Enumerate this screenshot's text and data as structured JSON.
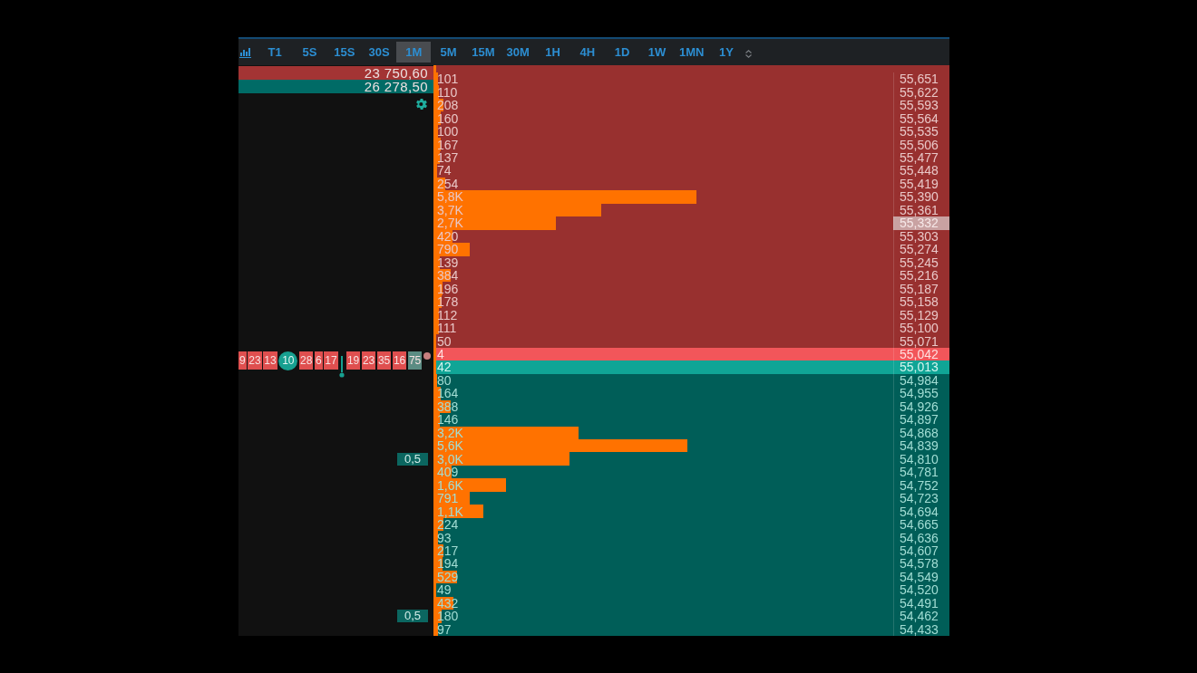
{
  "toolbar": {
    "timeframes": [
      {
        "label": "T1",
        "selected": false
      },
      {
        "label": "5S",
        "selected": false
      },
      {
        "label": "15S",
        "selected": false
      },
      {
        "label": "30S",
        "selected": false
      },
      {
        "label": "1M",
        "selected": true
      },
      {
        "label": "5M",
        "selected": false
      },
      {
        "label": "15M",
        "selected": false
      },
      {
        "label": "30M",
        "selected": false
      },
      {
        "label": "1H",
        "selected": false
      },
      {
        "label": "4H",
        "selected": false
      },
      {
        "label": "1D",
        "selected": false
      },
      {
        "label": "1W",
        "selected": false
      },
      {
        "label": "1MN",
        "selected": false
      },
      {
        "label": "1Y",
        "selected": false
      }
    ]
  },
  "totals": [
    {
      "value": "23 750,60",
      "color": "#a33434"
    },
    {
      "value": "26 278,50",
      "color": "#006b66"
    }
  ],
  "trades": [
    {
      "label": "9",
      "color": "#df4f4f",
      "kind": "box"
    },
    {
      "label": "23",
      "color": "#df4f4f",
      "kind": "box"
    },
    {
      "label": "13",
      "color": "#df4f4f",
      "kind": "box"
    },
    {
      "label": "10",
      "color": "#17a090",
      "kind": "bubble"
    },
    {
      "label": "28",
      "color": "#df4f4f",
      "kind": "box"
    },
    {
      "label": "6",
      "color": "#df4f4f",
      "kind": "box"
    },
    {
      "label": "17",
      "color": "#df4f4f",
      "kind": "box"
    },
    {
      "color": "#17a090",
      "kind": "pin"
    },
    {
      "label": "19",
      "color": "#df4f4f",
      "kind": "box"
    },
    {
      "label": "23",
      "color": "#df4f4f",
      "kind": "box"
    },
    {
      "label": "35",
      "color": "#df4f4f",
      "kind": "box"
    },
    {
      "label": "16",
      "color": "#df4f4f",
      "kind": "box"
    },
    {
      "label": "75",
      "color": "#5b8c83",
      "kind": "box"
    },
    {
      "color": "#c77f7f",
      "kind": "dot"
    }
  ],
  "ladder": {
    "rows": [
      {
        "kind": "ask",
        "volume": "101",
        "level": 0.01,
        "price": "55,651",
        "last_trade": false
      },
      {
        "kind": "ask",
        "volume": "110",
        "level": 0.011,
        "price": "55,622",
        "last_trade": false
      },
      {
        "kind": "ask",
        "volume": "208",
        "level": 0.021,
        "price": "55,593",
        "last_trade": false
      },
      {
        "kind": "ask",
        "volume": "160",
        "level": 0.016,
        "price": "55,564",
        "last_trade": false
      },
      {
        "kind": "ask",
        "volume": "100",
        "level": 0.01,
        "price": "55,535",
        "last_trade": false
      },
      {
        "kind": "ask",
        "volume": "167",
        "level": 0.016,
        "price": "55,506",
        "last_trade": false
      },
      {
        "kind": "ask",
        "volume": "137",
        "level": 0.014,
        "price": "55,477",
        "last_trade": false
      },
      {
        "kind": "ask",
        "volume": "74",
        "level": 0.007,
        "price": "55,448",
        "last_trade": false
      },
      {
        "kind": "ask",
        "volume": "254",
        "level": 0.025,
        "price": "55,419",
        "last_trade": false
      },
      {
        "kind": "ask",
        "volume": "5,8K",
        "level": 0.572,
        "price": "55,390",
        "last_trade": false
      },
      {
        "kind": "ask",
        "volume": "3,7K",
        "level": 0.365,
        "price": "55,361",
        "last_trade": false
      },
      {
        "kind": "ask",
        "volume": "2,7K",
        "level": 0.266,
        "price": "55,332",
        "last_trade": true
      },
      {
        "kind": "ask",
        "volume": "420",
        "level": 0.041,
        "price": "55,303",
        "last_trade": false
      },
      {
        "kind": "ask",
        "volume": "790",
        "level": 0.078,
        "price": "55,274",
        "last_trade": false
      },
      {
        "kind": "ask",
        "volume": "139",
        "level": 0.014,
        "price": "55,245",
        "last_trade": false
      },
      {
        "kind": "ask",
        "volume": "384",
        "level": 0.038,
        "price": "55,216",
        "last_trade": false
      },
      {
        "kind": "ask",
        "volume": "196",
        "level": 0.019,
        "price": "55,187",
        "last_trade": false
      },
      {
        "kind": "ask",
        "volume": "178",
        "level": 0.018,
        "price": "55,158",
        "last_trade": false
      },
      {
        "kind": "ask",
        "volume": "112",
        "level": 0.011,
        "price": "55,129",
        "last_trade": false
      },
      {
        "kind": "ask",
        "volume": "111",
        "level": 0.011,
        "price": "55,100",
        "last_trade": false
      },
      {
        "kind": "ask",
        "volume": "50",
        "level": 0.005,
        "price": "55,071",
        "last_trade": false
      },
      {
        "kind": "best_ask",
        "volume": "4",
        "level": 0,
        "price": "55,042",
        "last_trade": false
      },
      {
        "kind": "best_bid",
        "volume": "42",
        "level": 0.004,
        "price": "55,013",
        "last_trade": false
      },
      {
        "kind": "bid",
        "volume": "80",
        "level": 0.008,
        "price": "54,984",
        "last_trade": false
      },
      {
        "kind": "bid",
        "volume": "164",
        "level": 0.016,
        "price": "54,955",
        "last_trade": false
      },
      {
        "kind": "bid",
        "volume": "388",
        "level": 0.038,
        "price": "54,926",
        "last_trade": false
      },
      {
        "kind": "bid",
        "volume": "146",
        "level": 0.014,
        "price": "54,897",
        "last_trade": false
      },
      {
        "kind": "bid",
        "volume": "3,2K",
        "level": 0.316,
        "price": "54,868",
        "last_trade": false
      },
      {
        "kind": "bid",
        "volume": "5,6K",
        "level": 0.552,
        "price": "54,839",
        "last_trade": false
      },
      {
        "kind": "bid",
        "volume": "3,0K",
        "level": 0.296,
        "price": "54,810",
        "last_trade": false,
        "order_size": "0,5"
      },
      {
        "kind": "bid",
        "volume": "409",
        "level": 0.04,
        "price": "54,781",
        "last_trade": false
      },
      {
        "kind": "bid",
        "volume": "1,6K",
        "level": 0.158,
        "price": "54,752",
        "last_trade": false
      },
      {
        "kind": "bid",
        "volume": "791",
        "level": 0.078,
        "price": "54,723",
        "last_trade": false
      },
      {
        "kind": "bid",
        "volume": "1,1K",
        "level": 0.108,
        "price": "54,694",
        "last_trade": false
      },
      {
        "kind": "bid",
        "volume": "224",
        "level": 0.022,
        "price": "54,665",
        "last_trade": false
      },
      {
        "kind": "bid",
        "volume": "93",
        "level": 0.009,
        "price": "54,636",
        "last_trade": false
      },
      {
        "kind": "bid",
        "volume": "217",
        "level": 0.021,
        "price": "54,607",
        "last_trade": false
      },
      {
        "kind": "bid",
        "volume": "194",
        "level": 0.019,
        "price": "54,578",
        "last_trade": false
      },
      {
        "kind": "bid",
        "volume": "529",
        "level": 0.052,
        "price": "54,549",
        "last_trade": false
      },
      {
        "kind": "bid",
        "volume": "49",
        "level": 0.005,
        "price": "54,520",
        "last_trade": false
      },
      {
        "kind": "bid",
        "volume": "432",
        "level": 0.043,
        "price": "54,491",
        "last_trade": false
      },
      {
        "kind": "bid",
        "volume": "180",
        "level": 0.018,
        "price": "54,462",
        "last_trade": false,
        "order_size": "0,5"
      },
      {
        "kind": "bid",
        "volume": "97",
        "level": 0.01,
        "price": "54,433",
        "last_trade": false
      }
    ]
  }
}
